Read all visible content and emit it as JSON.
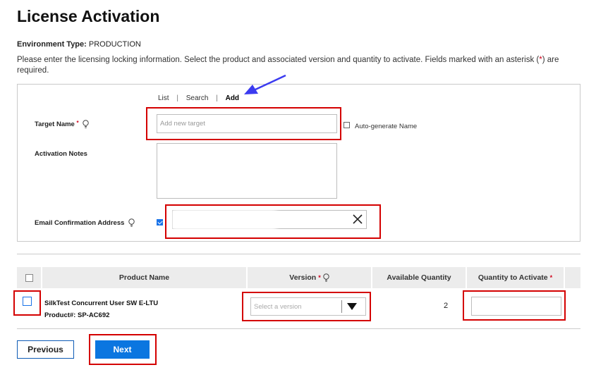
{
  "page_title": "License Activation",
  "environment": {
    "label": "Environment Type:",
    "value": "PRODUCTION"
  },
  "instructions": {
    "text_before": "Please enter the licensing locking information.  Select the product and associated version and quantity to activate.  Fields marked with an asterisk (",
    "asterisk": "*",
    "text_after": ") are required."
  },
  "tabs": {
    "list": "List",
    "search": "Search",
    "add": "Add",
    "separator": "|"
  },
  "form": {
    "target_name_label": "Target Name",
    "required_marker": "*",
    "target_name_placeholder": "Add new target",
    "auto_generate_label": "Auto-generate Name",
    "activation_notes_label": "Activation Notes",
    "email_label": "Email Confirmation Address",
    "email_checked": true
  },
  "table": {
    "headers": {
      "product_name": "Product Name",
      "version": "Version",
      "available_quantity": "Available Quantity",
      "quantity_to_activate": "Quantity to Activate"
    },
    "rows": [
      {
        "product_title": "SilkTest Concurrent User SW E-LTU",
        "product_number_label": "Product#:",
        "product_number": "SP-AC692",
        "version_placeholder": "Select a version",
        "available_quantity": "2"
      }
    ]
  },
  "buttons": {
    "previous": "Previous",
    "next": "Next"
  },
  "colors": {
    "accent_blue": "#0b76e0",
    "required_red": "#d0021b",
    "highlight_red": "#d40000",
    "annotation_arrow": "#3b3bf0"
  },
  "icons": {
    "hint": "lightbulb-icon",
    "clear": "close-x-icon",
    "dropdown": "triangle-down-icon",
    "annotation": "arrow-icon"
  }
}
